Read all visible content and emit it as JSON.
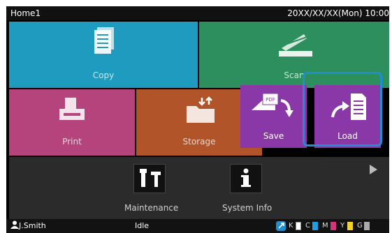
{
  "header": {
    "title": "Home1",
    "datetime": "20XX/XX/XX(Mon) 10:00"
  },
  "tiles": {
    "copy": "Copy",
    "scan": "Scan",
    "print": "Print",
    "storage": "Storage",
    "save": "Save",
    "load": "Load"
  },
  "tools": {
    "maintenance": "Maintenance",
    "system_info": "System Info"
  },
  "status": {
    "user": "J.Smith",
    "state": "Idle",
    "inks": [
      {
        "label": "K",
        "color": "#ffffff"
      },
      {
        "label": "C",
        "color": "#1ea0e0"
      },
      {
        "label": "M",
        "color": "#d8327c"
      },
      {
        "label": "Y",
        "color": "#f4d21e"
      },
      {
        "label": "G",
        "color": "#aaaaaa"
      }
    ]
  },
  "colors": {
    "copy": "#1f9bc0",
    "scan": "#2e8f5e",
    "print": "#b5447c",
    "storage": "#b2542a",
    "save_load": "#8a37a8",
    "highlight": "#1e8fd0"
  }
}
